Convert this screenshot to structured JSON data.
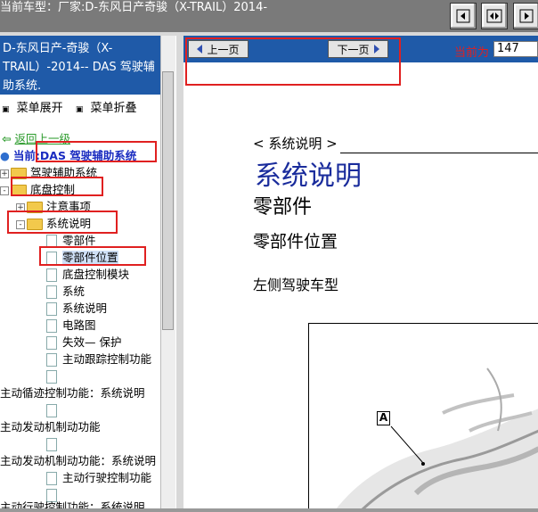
{
  "header": {
    "title": "当前车型：厂家:D-东风日产奇骏（X-TRAIL）2014-"
  },
  "sidebar": {
    "heading": "D-东风日产-奇骏（X-TRAIL）-2014-- DAS 驾驶辅助系统.",
    "expand_all": "菜单展开",
    "collapse_all": "菜单折叠",
    "back_link": "返回上一级",
    "current_label": "当前:DAS 驾驶辅助系统",
    "items": [
      {
        "label": "驾驶辅助系统",
        "type": "folder",
        "expander": "+"
      },
      {
        "label": "底盘控制",
        "type": "folder",
        "expander": "-"
      },
      {
        "label": "注意事项",
        "type": "folder",
        "expander": "+"
      },
      {
        "label": "系统说明",
        "type": "folder",
        "expander": "-"
      },
      {
        "label": "零部件",
        "type": "page"
      },
      {
        "label": "零部件位置",
        "type": "page"
      },
      {
        "label": "底盘控制模块",
        "type": "page"
      },
      {
        "label": "系统",
        "type": "page"
      },
      {
        "label": "系统说明",
        "type": "page"
      },
      {
        "label": "电路图",
        "type": "page"
      },
      {
        "label": "失效— 保护",
        "type": "page"
      },
      {
        "label": "主动跟踪控制功能",
        "type": "page"
      },
      {
        "label": "主动循迹控制功能：系统说明",
        "type": "text"
      },
      {
        "label": "主动发动机制动功能",
        "type": "text"
      },
      {
        "label": "主动发动机制动功能：系统说明",
        "type": "text"
      },
      {
        "label": "主动行驶控制功能",
        "type": "page"
      },
      {
        "label": "主动行驶控制功能：系统说明",
        "type": "text"
      }
    ]
  },
  "content": {
    "prev_label": "上一页",
    "next_label": "下一页",
    "current_page_label": "当前为",
    "current_page_value": "147",
    "breadcrumb": "< 系统说明 >",
    "title": "系统说明",
    "section": "零部件",
    "subsection": "零部件位置",
    "variant": "左侧驾驶车型",
    "callout": "A"
  },
  "colors": {
    "topbar": "#7a7a7a",
    "accent_blue": "#1f5aa8",
    "highlight_red": "#e02020",
    "title_blue": "#1a2c9c"
  }
}
